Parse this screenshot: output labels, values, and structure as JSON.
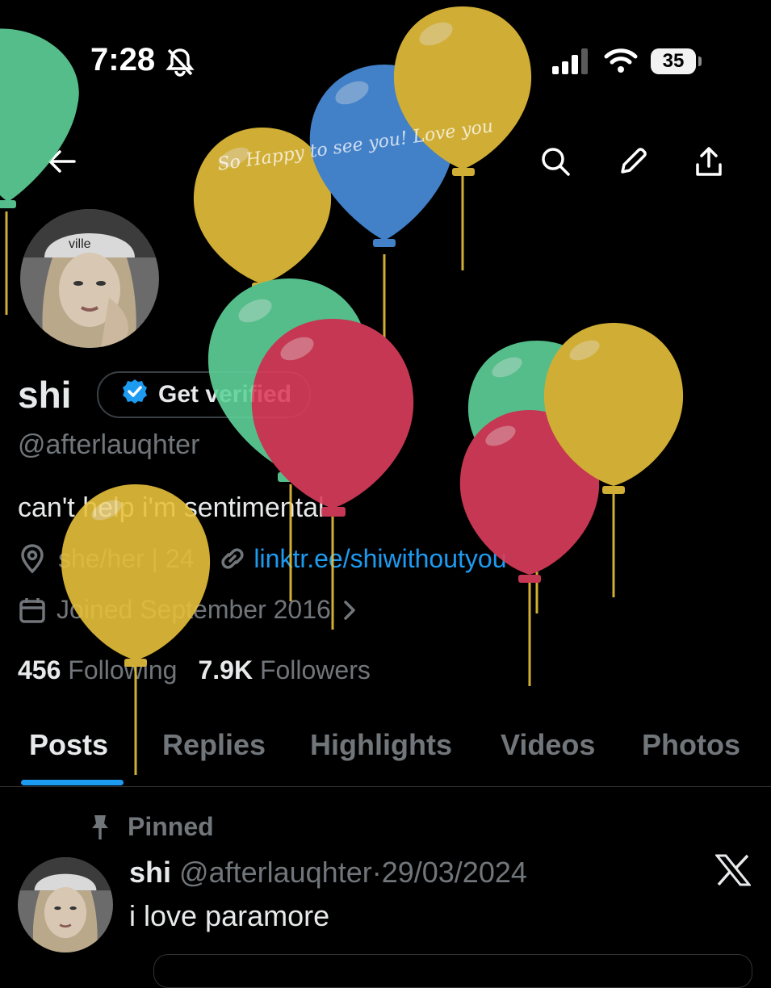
{
  "status_bar": {
    "time": "7:28",
    "battery": "35"
  },
  "header": {
    "overlay_text": "So Happy to see you! Love you"
  },
  "profile": {
    "name": "shi",
    "verify_label": "Get verified",
    "handle": "@afterlauqhter",
    "bio": "can't help i'm sentimental",
    "pronouns": "she/her | 24",
    "link": "linktr.ee/shiwithoutyou",
    "joined": "Joined September 2016",
    "following_count": "456",
    "following_label": "Following",
    "followers_count": "7.9K",
    "followers_label": "Followers"
  },
  "tabs": [
    "Posts",
    "Replies",
    "Highlights",
    "Videos",
    "Photos"
  ],
  "post": {
    "pinned_label": "Pinned",
    "name": "shi",
    "handle": "@afterlauqhter",
    "separator": "·",
    "date": "29/03/2024",
    "text": "i love paramore"
  },
  "colors": {
    "background": "#000000",
    "accent": "#1d9bf0",
    "muted": "#71767b",
    "balloon_yellow": "#e8c13c",
    "balloon_blue": "#4a8fdf",
    "balloon_green": "#5fd39a",
    "balloon_red": "#dc3e5c"
  },
  "icons": [
    "back-arrow-icon",
    "search-icon",
    "edit-pencil-icon",
    "share-icon",
    "location-icon",
    "link-icon",
    "calendar-icon",
    "pin-icon",
    "x-logo-icon",
    "bell-muted-icon",
    "signal-icon",
    "wifi-icon",
    "battery-icon",
    "verified-badge-icon"
  ]
}
